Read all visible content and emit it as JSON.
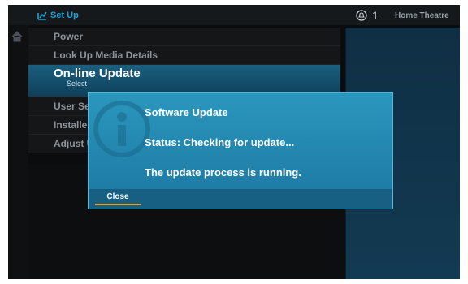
{
  "header": {
    "breadcrumb": "Set Up",
    "notification_count": "1",
    "location": "Home Theatre"
  },
  "menu": {
    "items": [
      {
        "label": "Power"
      },
      {
        "label": "Look Up Media Details"
      },
      {
        "label": "On-line Update",
        "sub": "Select"
      },
      {
        "label": "User Set"
      },
      {
        "label": "Installer"
      },
      {
        "label": "Adjust U"
      }
    ]
  },
  "dialog": {
    "title": "Software Update",
    "status": "Status: Checking for update...",
    "message": "The update process is running.",
    "close_label": "Close"
  },
  "colors": {
    "accent": "#1fa3d8",
    "dialog_bg": "#2b97bd",
    "focus": "#e0a21f"
  }
}
